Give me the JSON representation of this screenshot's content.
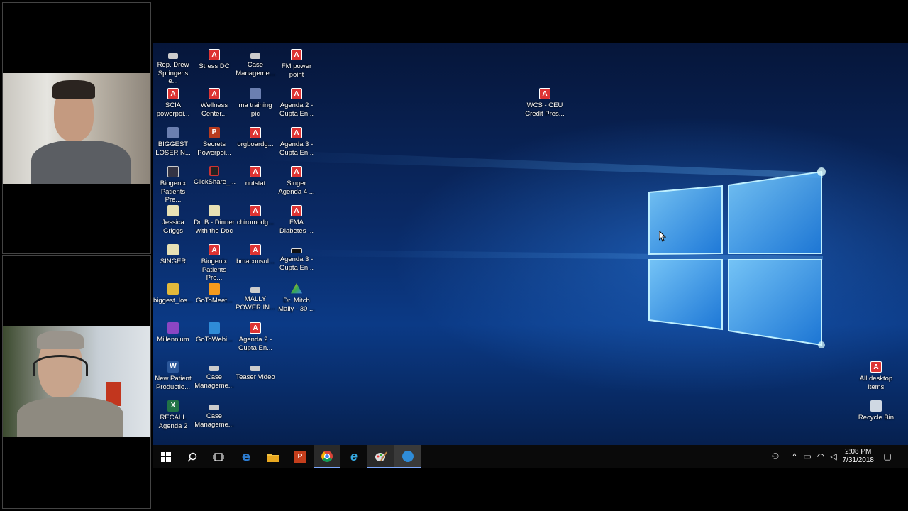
{
  "desktop": {
    "icons": [
      {
        "label": "Rep. Drew Springer's e...",
        "glyph": "vid",
        "icon": "video-file-icon"
      },
      {
        "label": "SCIA powerpoi...",
        "glyph": "pdf",
        "icon": "pdf-file-icon"
      },
      {
        "label": "BIGGEST LOSER N...",
        "glyph": "img",
        "icon": "image-file-icon"
      },
      {
        "label": "Biogenix Patients Pre...",
        "glyph": "mon",
        "icon": "video-file-icon"
      },
      {
        "label": "Jessica Griggs",
        "glyph": "doc",
        "icon": "document-file-icon"
      },
      {
        "label": "SINGER",
        "glyph": "doc",
        "icon": "document-file-icon"
      },
      {
        "label": "biggest_los...",
        "glyph": "zip",
        "icon": "zip-folder-icon"
      },
      {
        "label": "Millennium",
        "glyph": "mil",
        "icon": "millennium-app-icon"
      },
      {
        "label": "New Patient Productio...",
        "glyph": "word",
        "icon": "word-file-icon"
      },
      {
        "label": "RECALL Agenda 2",
        "glyph": "xl",
        "icon": "excel-file-icon"
      },
      {
        "label": "Stress DC",
        "glyph": "pdf",
        "icon": "pdf-file-icon"
      },
      {
        "label": "Wellness Center...",
        "glyph": "pdf",
        "icon": "pdf-file-icon"
      },
      {
        "label": "Secrets Powerpoi...",
        "glyph": "pp",
        "icon": "powerpoint-file-icon"
      },
      {
        "label": "ClickShare_...",
        "glyph": "cs",
        "icon": "clickshare-app-icon"
      },
      {
        "label": "Dr. B - Dinner with the Doc",
        "glyph": "doc",
        "icon": "document-file-icon"
      },
      {
        "label": "Biogenix Patients Pre...",
        "glyph": "pdf",
        "icon": "pdf-file-icon"
      },
      {
        "label": "GoToMeet...",
        "glyph": "gtm",
        "icon": "gotomeeting-app-icon"
      },
      {
        "label": "GoToWebi...",
        "glyph": "gtw",
        "icon": "gotowebinar-app-icon"
      },
      {
        "label": "Case Manageme...",
        "glyph": "vid",
        "icon": "video-file-icon"
      },
      {
        "label": "Case Manageme...",
        "glyph": "vid",
        "icon": "video-file-icon"
      },
      {
        "label": "Case Manageme...",
        "glyph": "vid",
        "icon": "video-file-icon"
      },
      {
        "label": "ma training pic",
        "glyph": "img",
        "icon": "image-file-icon"
      },
      {
        "label": "orgboardg...",
        "glyph": "pdf",
        "icon": "pdf-file-icon"
      },
      {
        "label": "nutstat",
        "glyph": "pdf",
        "icon": "pdf-file-icon"
      },
      {
        "label": "chiromodg...",
        "glyph": "pdf",
        "icon": "pdf-file-icon"
      },
      {
        "label": "bmaconsul...",
        "glyph": "pdf",
        "icon": "pdf-file-icon"
      },
      {
        "label": "MALLY POWER IN...",
        "glyph": "vid",
        "icon": "video-file-icon"
      },
      {
        "label": "Agenda 2 - Gupta En...",
        "glyph": "pdf",
        "icon": "pdf-file-icon"
      },
      {
        "label": "Teaser Video",
        "glyph": "vid",
        "icon": "video-file-icon"
      },
      {
        "label": "FM power point",
        "glyph": "pdf",
        "icon": "pdf-file-icon"
      },
      {
        "label": "Agenda 2 - Gupta En...",
        "glyph": "pdf",
        "icon": "pdf-file-icon"
      },
      {
        "label": "Agenda 3 - Gupta En...",
        "glyph": "pdf",
        "icon": "pdf-file-icon"
      },
      {
        "label": "Singer Agenda 4 ...",
        "glyph": "pdf",
        "icon": "pdf-file-icon"
      },
      {
        "label": "FMA Diabetes ...",
        "glyph": "pdf",
        "icon": "pdf-file-icon"
      },
      {
        "label": "Agenda 3 - Gupta En...",
        "glyph": "bar",
        "icon": "video-file-icon"
      },
      {
        "label": "Dr. Mitch Mally - 30 ...",
        "glyph": "gd",
        "icon": "google-drive-icon"
      },
      {
        "label": "WCS - CEU Credit Pres...",
        "glyph": "pdf",
        "icon": "pdf-file-icon"
      },
      {
        "label": "All desktop items",
        "glyph": "pdf",
        "icon": "pdf-file-icon"
      },
      {
        "label": "Recycle Bin",
        "glyph": "bin",
        "icon": "recycle-bin-icon"
      }
    ]
  },
  "taskbar": {
    "apps": [
      {
        "name": "start-button",
        "icon": "windows-start-icon"
      },
      {
        "name": "search-button",
        "icon": "search-icon"
      },
      {
        "name": "task-view-button",
        "icon": "task-view-icon"
      },
      {
        "name": "edge-button",
        "icon": "edge-icon"
      },
      {
        "name": "file-explorer-button",
        "icon": "folder-icon"
      },
      {
        "name": "powerpoint-button",
        "icon": "powerpoint-icon"
      },
      {
        "name": "chrome-button",
        "icon": "chrome-icon"
      },
      {
        "name": "internet-explorer-button",
        "icon": "internet-explorer-icon"
      },
      {
        "name": "paint-button",
        "icon": "paint-icon"
      },
      {
        "name": "gotowebinar-button",
        "icon": "gotowebinar-icon"
      }
    ],
    "time": "2:08 PM",
    "date": "7/31/2018"
  },
  "colors": {
    "accent": "#7aa7ff",
    "taskbar": "#0a0a0a",
    "desktop": "#0a2a66"
  }
}
